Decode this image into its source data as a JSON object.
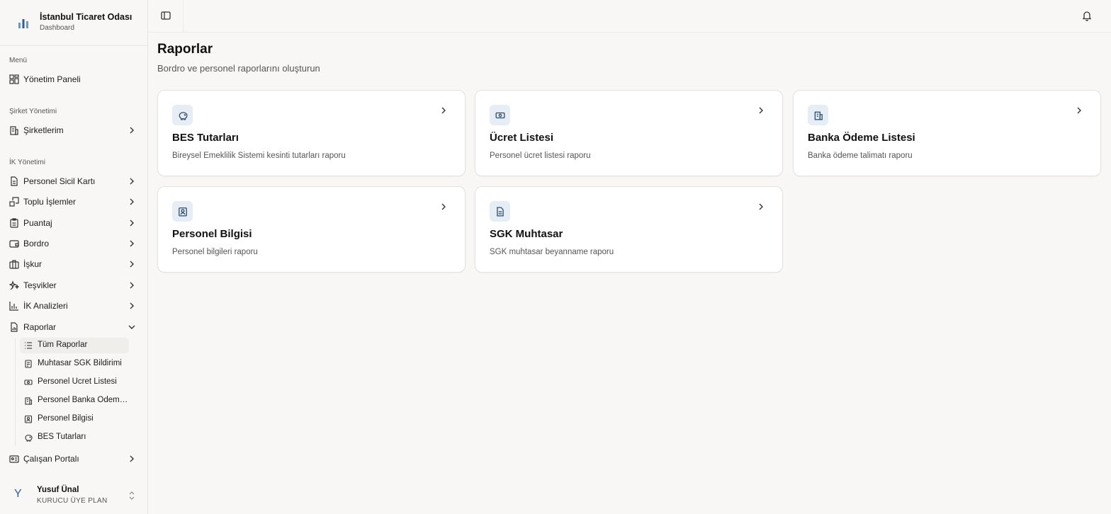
{
  "brand": {
    "title": "İstanbul Ticaret Odası",
    "subtitle": "Dashboard"
  },
  "sidebar": {
    "sections": [
      {
        "label": "Menü"
      },
      {
        "label": "Şirket Yönetimi"
      },
      {
        "label": "İK Yönetimi"
      }
    ],
    "items": [
      {
        "label": "Yönetim Paneli",
        "icon": "dashboard-grid-icon"
      },
      {
        "label": "Şirketlerim",
        "icon": "building-icon"
      },
      {
        "label": "Personel Sicil Kartı",
        "icon": "file-text-icon"
      },
      {
        "label": "Toplu İşlemler",
        "icon": "bulk-actions-icon"
      },
      {
        "label": "Puantaj",
        "icon": "clipboard-icon"
      },
      {
        "label": "Bordro",
        "icon": "wallet-icon"
      },
      {
        "label": "İşkur",
        "icon": "briefcase-icon"
      },
      {
        "label": "Teşvikler",
        "icon": "sparkles-icon"
      },
      {
        "label": "İK Analizleri",
        "icon": "bar-chart-icon"
      },
      {
        "label": "Raporlar",
        "icon": "report-icon"
      },
      {
        "label": "Çalışan Portalı",
        "icon": "id-card-icon"
      }
    ],
    "reports_sub": [
      {
        "label": "Tüm Raporlar",
        "icon": "list-icon"
      },
      {
        "label": "Muhtasar SGK Bildirimi",
        "icon": "receipt-icon"
      },
      {
        "label": "Personel Ücret Listesi",
        "icon": "banknote-icon"
      },
      {
        "label": "Personel Banka Ödeme Listesi",
        "icon": "bank-icon"
      },
      {
        "label": "Personel Bilgisi",
        "icon": "contact-icon"
      },
      {
        "label": "BES Tutarları",
        "icon": "piggy-bank-icon"
      }
    ]
  },
  "user": {
    "name": "Yusuf Ünal",
    "plan": "KURUCU ÜYE PLAN",
    "avatar_letter": "Y"
  },
  "page": {
    "title": "Raporlar",
    "subtitle": "Bordro ve personel raporlarını oluşturun"
  },
  "cards": [
    {
      "title": "BES Tutarları",
      "description": "Bireysel Emeklilik Sistemi kesinti tutarları raporu",
      "icon": "piggy-bank-icon"
    },
    {
      "title": "Ücret Listesi",
      "description": "Personel ücret listesi raporu",
      "icon": "banknote-icon"
    },
    {
      "title": "Banka Ödeme Listesi",
      "description": "Banka ödeme talimatı raporu",
      "icon": "bank-icon"
    },
    {
      "title": "Personel Bilgisi",
      "description": "Personel bilgileri raporu",
      "icon": "contact-icon"
    },
    {
      "title": "SGK Muhtasar",
      "description": "SGK muhtasar beyanname raporu",
      "icon": "file-text-icon"
    }
  ],
  "colors": {
    "accent": "#2b5ea7",
    "icon_bg": "#e6edf5",
    "active_bg": "#efeeeb",
    "page_bg": "#f8f7f5"
  }
}
